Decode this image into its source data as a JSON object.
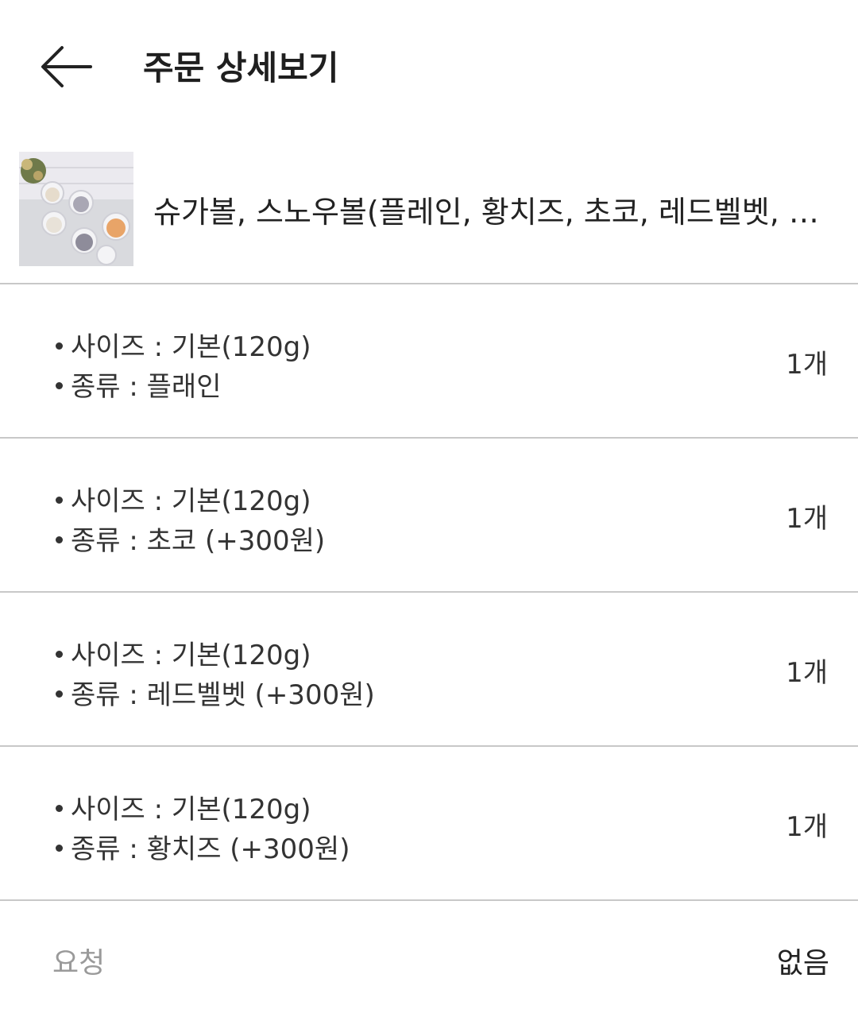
{
  "header": {
    "title": "주문 상세보기",
    "back_icon": "arrow-left-icon"
  },
  "product": {
    "name": "슈가볼, 스노우볼(플레인, 황치즈, 초코, 레드벨벳, 인…",
    "thumbnail": "product-photo"
  },
  "options": [
    {
      "size": "사이즈 : 기본(120g)",
      "type": "종류 : 플래인",
      "qty": "1개"
    },
    {
      "size": "사이즈 : 기본(120g)",
      "type": "종류 : 초코 (+300원)",
      "qty": "1개"
    },
    {
      "size": "사이즈 : 기본(120g)",
      "type": "종류 : 레드벨벳 (+300원)",
      "qty": "1개"
    },
    {
      "size": "사이즈 : 기본(120g)",
      "type": "종류 : 황치즈 (+300원)",
      "qty": "1개"
    }
  ],
  "request": {
    "label": "요청",
    "value": "없음"
  }
}
